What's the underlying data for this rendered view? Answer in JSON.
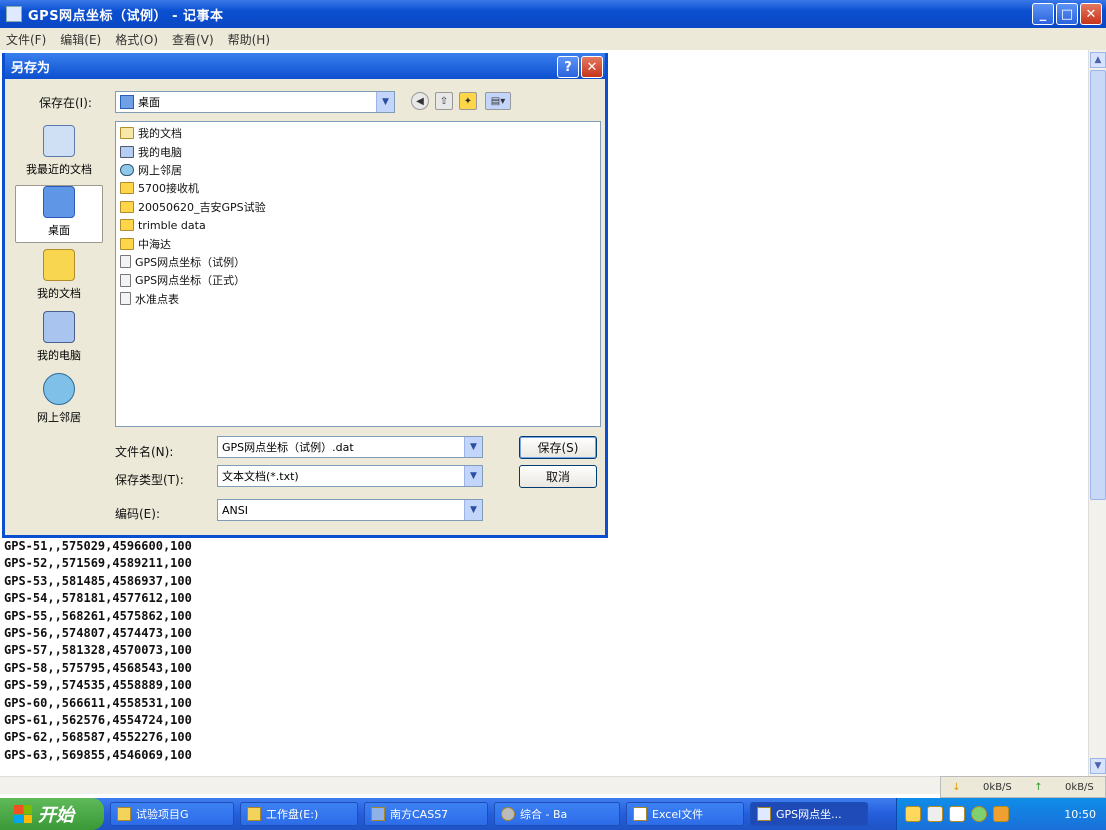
{
  "window": {
    "title": "GPS网点坐标（试例） - 记事本",
    "btn_min": "_",
    "btn_max": "□",
    "btn_close": "✕"
  },
  "menu": [
    "文件(F)",
    "编辑(E)",
    "格式(O)",
    "查看(V)",
    "帮助(H)"
  ],
  "editor": {
    "lines": [
      "GPS-51,,575029,4596600,100",
      "GPS-52,,571569,4589211,100",
      "GPS-53,,581485,4586937,100",
      "GPS-54,,578181,4577612,100",
      "GPS-55,,568261,4575862,100",
      "GPS-56,,574807,4574473,100",
      "GPS-57,,581328,4570073,100",
      "GPS-58,,575795,4568543,100",
      "GPS-59,,574535,4558889,100",
      "GPS-60,,566611,4558531,100",
      "GPS-61,,562576,4554724,100",
      "GPS-62,,568587,4552276,100",
      "GPS-63,,569855,4546069,100"
    ]
  },
  "status": {
    "left": "0kB/S",
    "right": "0kB/S"
  },
  "dialog": {
    "title": "另存为",
    "help_btn": "?",
    "close_btn": "✕",
    "save_in_label": "保存在(I):",
    "save_in_value": "桌面",
    "places": [
      "我最近的文档",
      "桌面",
      "我的文档",
      "我的电脑",
      "网上邻居"
    ],
    "files": [
      {
        "name": "我的文档",
        "kind": "mydoc"
      },
      {
        "name": "我的电脑",
        "kind": "pc"
      },
      {
        "name": "网上邻居",
        "kind": "net"
      },
      {
        "name": "5700接收机",
        "kind": "folder"
      },
      {
        "name": "20050620_吉安GPS试验",
        "kind": "folder"
      },
      {
        "name": "trimble data",
        "kind": "folder"
      },
      {
        "name": "中海达",
        "kind": "folder"
      },
      {
        "name": "GPS网点坐标（试例）",
        "kind": "doc"
      },
      {
        "name": "GPS网点坐标（正式）",
        "kind": "doc"
      },
      {
        "name": "水准点表",
        "kind": "doc"
      }
    ],
    "filename_label": "文件名(N):",
    "filename_value": "GPS网点坐标（试例）.dat",
    "filetype_label": "保存类型(T):",
    "filetype_value": "文本文档(*.txt)",
    "encoding_label": "编码(E):",
    "encoding_value": "ANSI",
    "save_btn": "保存(S)",
    "cancel_btn": "取消"
  },
  "taskbar": {
    "start": "开始",
    "tasks": [
      "试验项目G",
      "工作盘(E:)",
      "南方CASS7",
      "综合 - Ba",
      "Excel文件",
      "GPS网点坐..."
    ],
    "clock": "10:50"
  }
}
